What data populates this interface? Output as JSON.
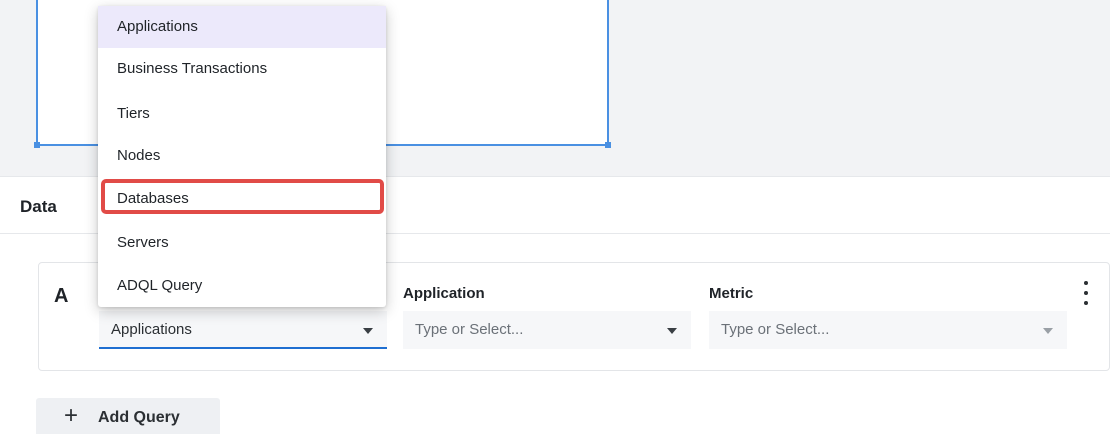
{
  "data_panel": {
    "title": "Data"
  },
  "query": {
    "letter": "A",
    "source_select": {
      "value": "Applications"
    },
    "application": {
      "label": "Application",
      "placeholder": "Type or Select..."
    },
    "metric": {
      "label": "Metric",
      "placeholder": "Type or Select..."
    }
  },
  "add_query": {
    "plus": "+",
    "label": "Add Query"
  },
  "dropdown": {
    "items": [
      {
        "label": "Applications",
        "state": "selected"
      },
      {
        "label": "Business Transactions",
        "state": "normal"
      },
      {
        "label": "Tiers",
        "state": "normal"
      },
      {
        "label": "Nodes",
        "state": "normal"
      },
      {
        "label": "Databases",
        "state": "highlighted"
      },
      {
        "label": "Servers",
        "state": "normal"
      },
      {
        "label": "ADQL Query",
        "state": "normal"
      }
    ]
  },
  "colors": {
    "accent": "#1f6fd1",
    "widget_border": "#4a90e2",
    "highlight_outline": "#e14b47",
    "selected_item_bg": "#ece9fb"
  },
  "icons": {
    "dropdown_arrow": "chevron-down-icon",
    "more": "more-vertical-icon",
    "add": "plus-icon"
  }
}
